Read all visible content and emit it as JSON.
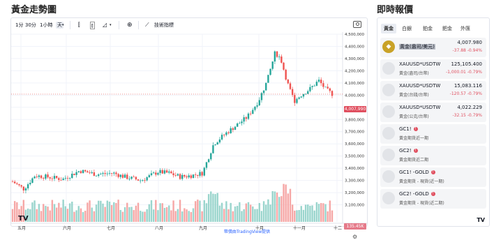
{
  "page": {
    "left_title": "黃金走勢圖",
    "right_title": "即時報價",
    "attribution": "幣價由TradingView提供"
  },
  "toolbar": {
    "items": [
      "1分",
      "30分",
      "1小時",
      "天"
    ],
    "indicators_label": "技術指標"
  },
  "chart_data": {
    "type": "candlestick",
    "x_labels": [
      "五月",
      "六月",
      "七月",
      "八月",
      "九月",
      "十月",
      "十一月",
      "十二"
    ],
    "y_ticks": [
      3100000,
      3200000,
      3300000,
      3400000,
      3500000,
      3600000,
      3700000,
      3800000,
      3900000,
      4000000,
      4100000,
      4200000,
      4300000,
      4400000,
      4500000
    ],
    "y_tick_labels": [
      "3,100,000",
      "3,200,000",
      "3,300,000",
      "3,400,000",
      "3,500,000",
      "3,600,000",
      "3,700,000",
      "3,800,000",
      "3,900,000",
      "4,000,000",
      "4,100,000",
      "4,200,000",
      "4,300,000",
      "4,400,000",
      "4,500,000"
    ],
    "ylim": [
      3000000,
      4500000
    ],
    "last_price_label": "4,007,990",
    "volume_label": "135.45K",
    "colors": {
      "up": "#26a69a",
      "down": "#ef5350",
      "vol_up": "#9ad5cd",
      "vol_down": "#f6a7a6"
    }
  },
  "quotes": {
    "tabs": [
      "黃金",
      "白銀",
      "鉑金",
      "鈀金",
      "外匯"
    ],
    "active_tab": 0,
    "rows": [
      {
        "symbol": "黃金(盎司/美元)",
        "desc": "",
        "price": "4,007.980",
        "change": "-37.88",
        "pct": "-0.94%",
        "icon": "gold-coin-icon",
        "highlight": true
      },
      {
        "symbol": "XAUUSD*USDTWD",
        "desc": "黃金(盎司/台幣)",
        "price": "125,105.400",
        "change": "-1,000.01",
        "pct": "-0.79%",
        "icon": "circle-icon"
      },
      {
        "symbol": "XAUUSD*USDTWD",
        "desc": "黃金(台錢/台幣)",
        "price": "15,083.116",
        "change": "-120.57",
        "pct": "-0.79%",
        "icon": "circle-icon"
      },
      {
        "symbol": "XAUUSD*USDTWD/",
        "desc": "黃金(公克/台幣)",
        "price": "4,022.229",
        "change": "-32.15",
        "pct": "-0.79%",
        "icon": "circle-icon"
      },
      {
        "symbol": "GC1!",
        "desc": "黃金期貨近一期",
        "price": "",
        "change": "",
        "pct": "",
        "icon": "circle-icon",
        "info": true
      },
      {
        "symbol": "GC2!",
        "desc": "黃金期貨近二期",
        "price": "",
        "change": "",
        "pct": "",
        "icon": "circle-icon",
        "info": true
      },
      {
        "symbol": "GC1! -GOLD",
        "desc": "黃金期貨 - 現貨(近一期)",
        "price": "",
        "change": "",
        "pct": "",
        "icon": "circle-icon",
        "info": true
      },
      {
        "symbol": "GC2! -GOLD",
        "desc": "黃金期貨 - 現貨(近二期)",
        "price": "",
        "change": "",
        "pct": "",
        "icon": "circle-icon",
        "info": true
      }
    ]
  }
}
